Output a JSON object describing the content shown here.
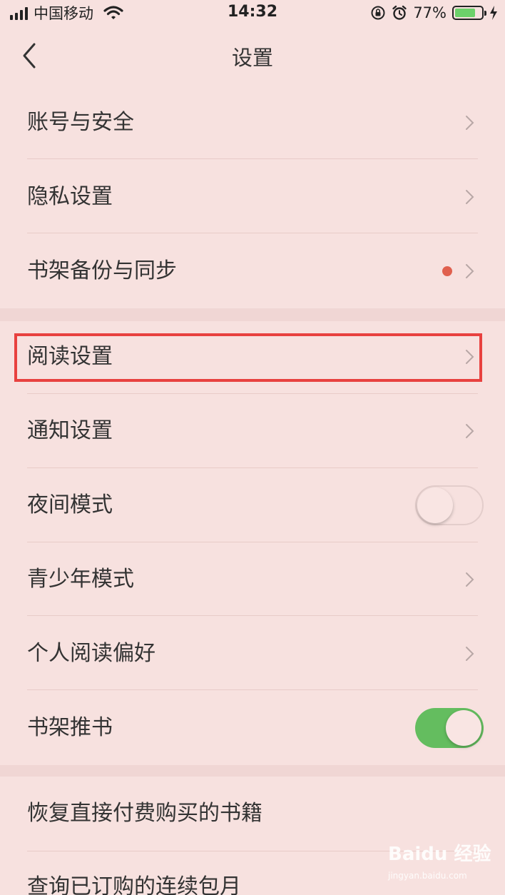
{
  "status_bar": {
    "carrier": "中国移动",
    "time": "14:32",
    "battery_percent": "77%",
    "battery_level": 0.77,
    "icons": [
      "signal-icon",
      "wifi-icon",
      "rotation-lock-icon",
      "alarm-icon",
      "battery-icon",
      "charging-bolt-icon"
    ]
  },
  "nav": {
    "title": "设置",
    "back_icon": "chevron-left-icon"
  },
  "rows": {
    "account_security": "账号与安全",
    "privacy": "隐私设置",
    "shelf_backup": "书架备份与同步",
    "reading_settings": "阅读设置",
    "notification": "通知设置",
    "night_mode": "夜间模式",
    "teen_mode": "青少年模式",
    "reading_pref": "个人阅读偏好",
    "shelf_recommend": "书架推书",
    "restore_purchases": "恢复直接付费购买的书籍",
    "query_subscription": "查询已订购的连续包月"
  },
  "toggles": {
    "night_mode": false,
    "shelf_recommend": true
  },
  "colors": {
    "background": "#f7e1df",
    "toggle_on": "#64bd5f",
    "badge_dot": "#e0604e",
    "highlight": "#e8413f"
  },
  "watermark": {
    "brand": "Baidu 经验",
    "url": "jingyan.baidu.com"
  }
}
